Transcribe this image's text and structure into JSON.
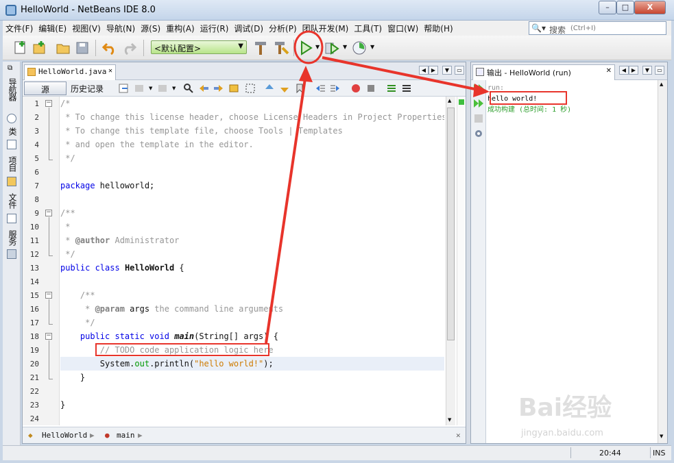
{
  "window": {
    "title": "HelloWorld - NetBeans IDE 8.0",
    "min": "–",
    "max": "□",
    "close": "X"
  },
  "menu": [
    "文件(F)",
    "编辑(E)",
    "视图(V)",
    "导航(N)",
    "源(S)",
    "重构(A)",
    "运行(R)",
    "调试(D)",
    "分析(P)",
    "团队开发(M)",
    "工具(T)",
    "窗口(W)",
    "帮助(H)"
  ],
  "search": {
    "label": "搜索",
    "placeholder": "(Ctrl+I)"
  },
  "toolbar": {
    "config": "<默认配置>"
  },
  "left_tabs": [
    "导航器",
    "类",
    "项目",
    "文件",
    "服务"
  ],
  "editor": {
    "tab": "HelloWorld.java",
    "source_btn": "源",
    "history_btn": "历史记录",
    "lines": [
      "1",
      "2",
      "3",
      "4",
      "5",
      "6",
      "7",
      "8",
      "9",
      "10",
      "11",
      "12",
      "13",
      "14",
      "15",
      "16",
      "17",
      "18",
      "19",
      "20",
      "21",
      "22",
      "23",
      "24"
    ],
    "code": {
      "l1": "/*",
      "l2": " * To change this license header, choose License Headers in Project Properties.",
      "l3": " * To change this template file, choose Tools | Templates",
      "l4": " * and open the template in the editor.",
      "l5": " */",
      "l7_kw": "package",
      "l7_rest": " helloworld;",
      "l9": "/**",
      "l10": " *",
      "l11_a": " * ",
      "l11_ann": "@author",
      "l11_b": " Administrator",
      "l12": " */",
      "l13_kw": "public class",
      "l13_name": "HelloWorld",
      "l13_rest": " {",
      "l15": "    /**",
      "l16_a": "     * ",
      "l16_ann": "@param",
      "l16_arg": " args",
      "l16_b": " the command line arguments",
      "l17": "     */",
      "l18_kw": "    public static void",
      "l18_name": "main",
      "l18_rest": "(String[] args) {",
      "l19": "        // TODO code application logic here",
      "l20_a": "        System.",
      "l20_fld": "out",
      "l20_b": ".println(",
      "l20_str": "\"hello world!\"",
      "l20_c": ");",
      "l21": "    }",
      "l23": "}"
    },
    "breadcrumb": [
      "HelloWorld",
      "main"
    ]
  },
  "output": {
    "tab": "输出 - HelloWorld (run)",
    "run": "run:",
    "hello": "hello world!",
    "built": "成功构建 (总时间: 1 秒)"
  },
  "status": {
    "position": "20:44",
    "mode": "INS"
  },
  "watermark": {
    "brand": "Bai经验",
    "site": "jingyan.baidu.com"
  },
  "colors": {
    "annotation_red": "#e8342b",
    "keyword": "#0000e6",
    "string": "#ce7b00",
    "comment": "#969696"
  }
}
